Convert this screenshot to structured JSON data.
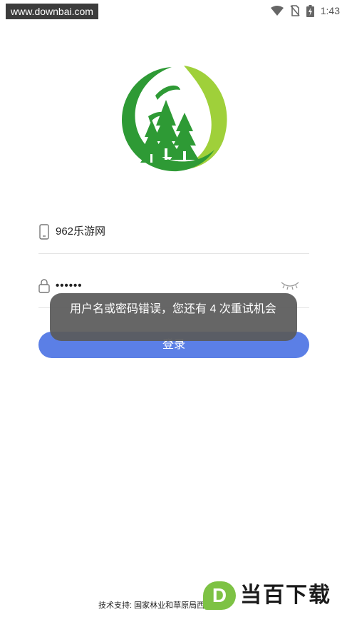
{
  "status_bar": {
    "watermark_url": "www.downbai.com",
    "time": "1:43",
    "icons": [
      "wifi-icon",
      "no-sim-icon",
      "battery-charging-icon"
    ]
  },
  "logo": {
    "icon": "forest-leaf-logo",
    "colors": {
      "dark_green": "#2e9a35",
      "light_green": "#9fd03a"
    }
  },
  "login_form": {
    "phone": {
      "icon": "phone-icon",
      "value": "962乐游网"
    },
    "password": {
      "icon": "lock-icon",
      "value": "••••••",
      "toggle_icon": "eye-closed-icon"
    },
    "login_button": "登录"
  },
  "toast": {
    "message": "用户名或密码错误，您还有 4 次重试机会"
  },
  "footer": {
    "support_text": "技术支持: 国家林业和草原局西:"
  },
  "brand_watermark": {
    "letter": "D",
    "text": "当百下载"
  },
  "colors": {
    "accent": "#5b7fe6",
    "toast_bg": "#5a5a5a"
  }
}
